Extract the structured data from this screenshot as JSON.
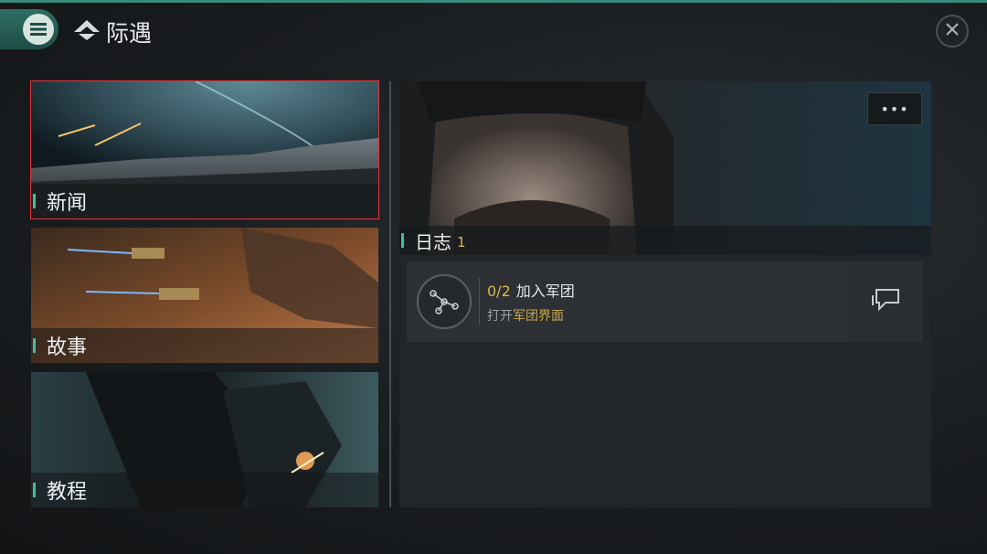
{
  "header": {
    "title": "际遇",
    "menu_icon": "hamburger-menu-icon",
    "logo_icon": "faction-emblem-icon",
    "close_icon": "close-icon"
  },
  "categories": [
    {
      "label": "新闻",
      "selected": true
    },
    {
      "label": "故事",
      "selected": false
    },
    {
      "label": "教程",
      "selected": false
    }
  ],
  "journal": {
    "title": "日志",
    "count": "1",
    "more_label": "•••",
    "task": {
      "progress": "0/2",
      "name": "加入军团",
      "hint_prefix": "打开",
      "hint_link": "军团界面",
      "icon": "network-nodes-icon",
      "action_icon": "chat-bubble-icon"
    }
  },
  "colors": {
    "accent": "#3fbfa0",
    "selected_border": "#e8343a",
    "highlight": "#d9b84a"
  }
}
